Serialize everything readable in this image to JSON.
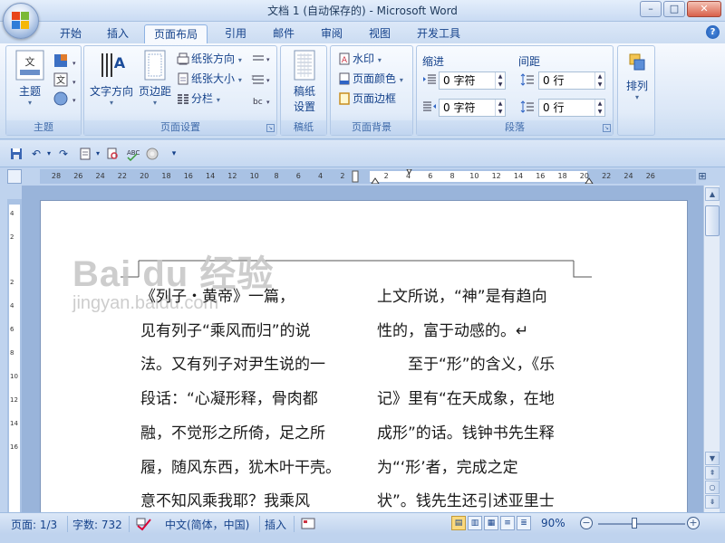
{
  "window": {
    "title": "文档 1 (自动保存的) - Microsoft Word",
    "minimize": "–",
    "maximize": "□",
    "close": "✕"
  },
  "tabs": [
    "开始",
    "插入",
    "页面布局",
    "引用",
    "邮件",
    "审阅",
    "视图",
    "开发工具"
  ],
  "ribbon": {
    "theme": {
      "button": "主题",
      "group": "主题"
    },
    "page_setup": {
      "text_direction": "文字方向",
      "margins": "页边距",
      "orientation": "纸张方向",
      "size": "纸张大小",
      "columns": "分栏",
      "group": "页面设置"
    },
    "manuscript": {
      "button_line1": "稿纸",
      "button_line2": "设置",
      "group": "稿纸"
    },
    "page_background": {
      "watermark": "水印",
      "page_color": "页面颜色",
      "page_border": "页面边框",
      "group": "页面背景"
    },
    "paragraph": {
      "indent_label": "缩进",
      "spacing_label": "间距",
      "indent_left": "0 字符",
      "indent_right": "0 字符",
      "spacing_before": "0 行",
      "spacing_after": "0 行",
      "group": "段落"
    },
    "arrange": {
      "button": "排列"
    }
  },
  "ruler": {
    "ticks": [
      "28",
      "26",
      "24",
      "22",
      "20",
      "18",
      "16",
      "14",
      "12",
      "10",
      "8",
      "6",
      "4",
      "2",
      "2",
      "4",
      "6",
      "8",
      "10",
      "12",
      "14",
      "16",
      "18",
      "20",
      "22",
      "24",
      "26"
    ],
    "vticks": [
      "4",
      "2",
      "2",
      "4",
      "6",
      "8",
      "10",
      "12",
      "14",
      "16"
    ]
  },
  "document": {
    "watermark_main": "Bai du 经验",
    "watermark_sub": "jingyan.baidu.com",
    "col1": [
      "《列子・黄帝》一篇，",
      "见有列子“乘风而归”的说",
      "法。又有列子对尹生说的一",
      "段话：“心凝形释，骨肉都",
      "融，不觉形之所倚，足之所",
      "履，随风东西，犹木叶干壳。",
      "意不知风乘我耶？我乘风"
    ],
    "col2": [
      "上文所说，“神”是有趋向",
      "性的，富于动感的。↵",
      "　　至于“形”的含义，《乐",
      "记》里有“在天成象，在地",
      "成形”的话。钱钟书先生释",
      "为“‘形’者，完成之定",
      "状”。钱先生还引述亚里士"
    ]
  },
  "status": {
    "page": "页面: 1/3",
    "words": "字数: 732",
    "language": "中文(简体，中国)",
    "insert_mode": "插入",
    "zoom": "90%"
  }
}
